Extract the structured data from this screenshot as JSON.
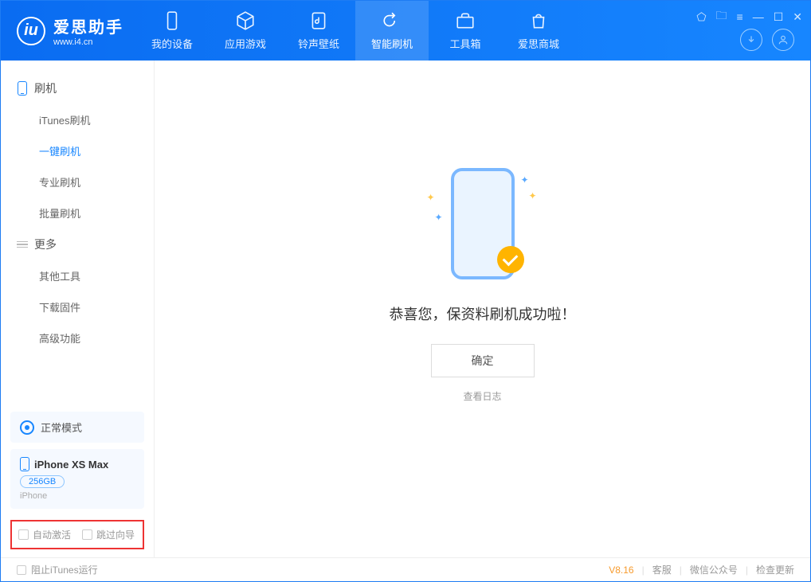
{
  "app": {
    "name": "爱思助手",
    "site": "www.i4.cn"
  },
  "tabs": {
    "device": "我的设备",
    "apps": "应用游戏",
    "ring": "铃声壁纸",
    "flash": "智能刷机",
    "tool": "工具箱",
    "shop": "爱思商城"
  },
  "sidebar": {
    "sec1": "刷机",
    "items1": {
      "itunes": "iTunes刷机",
      "oneclick": "一键刷机",
      "pro": "专业刷机",
      "batch": "批量刷机"
    },
    "sec2": "更多",
    "items2": {
      "other": "其他工具",
      "firmware": "下载固件",
      "advanced": "高级功能"
    }
  },
  "mode": {
    "label": "正常模式"
  },
  "device": {
    "name": "iPhone XS Max",
    "storage": "256GB",
    "type": "iPhone"
  },
  "checks": {
    "auto": "自动激活",
    "skip": "跳过向导"
  },
  "result": {
    "msg": "恭喜您，保资料刷机成功啦！",
    "ok": "确定",
    "log": "查看日志"
  },
  "footer": {
    "itunes": "阻止iTunes运行",
    "ver": "V8.16",
    "kefu": "客服",
    "wx": "微信公众号",
    "update": "检查更新"
  }
}
